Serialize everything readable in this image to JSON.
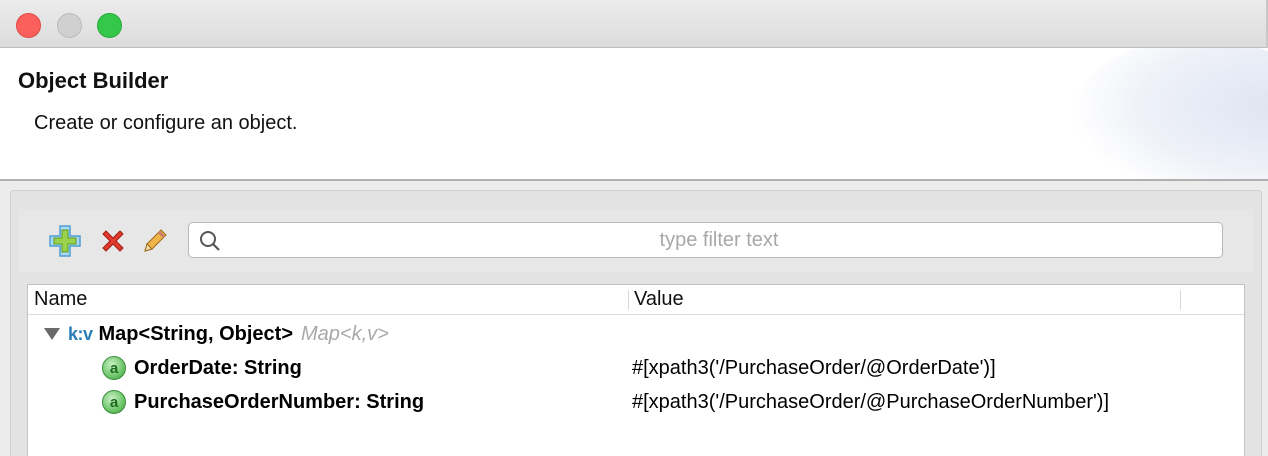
{
  "window": {
    "buttons": [
      "close",
      "minimize",
      "zoom"
    ]
  },
  "header": {
    "title": "Object Builder",
    "subtitle": "Create or configure an object."
  },
  "toolbar": {
    "icons": [
      "add-icon",
      "delete-icon",
      "edit-icon"
    ],
    "filter_placeholder": "type filter text",
    "filter_value": ""
  },
  "tree": {
    "columns": [
      "Name",
      "Value"
    ],
    "root": {
      "tag": "k:v",
      "label": "Map<String, Object>",
      "type_hint": "Map<k,v>",
      "expanded": true
    },
    "children": [
      {
        "icon": "a",
        "name": "OrderDate: String",
        "value": "#[xpath3('/PurchaseOrder/@OrderDate')]"
      },
      {
        "icon": "a",
        "name": "PurchaseOrderNumber: String",
        "value": "#[xpath3('/PurchaseOrder/@PurchaseOrderNumber')]"
      }
    ]
  },
  "colors": {
    "close": "#fc605c",
    "minimize": "#d0d0d0",
    "zoom": "#34c84a",
    "kv_tag": "#2a7fb8",
    "attribute_icon": "#6fc66a"
  }
}
